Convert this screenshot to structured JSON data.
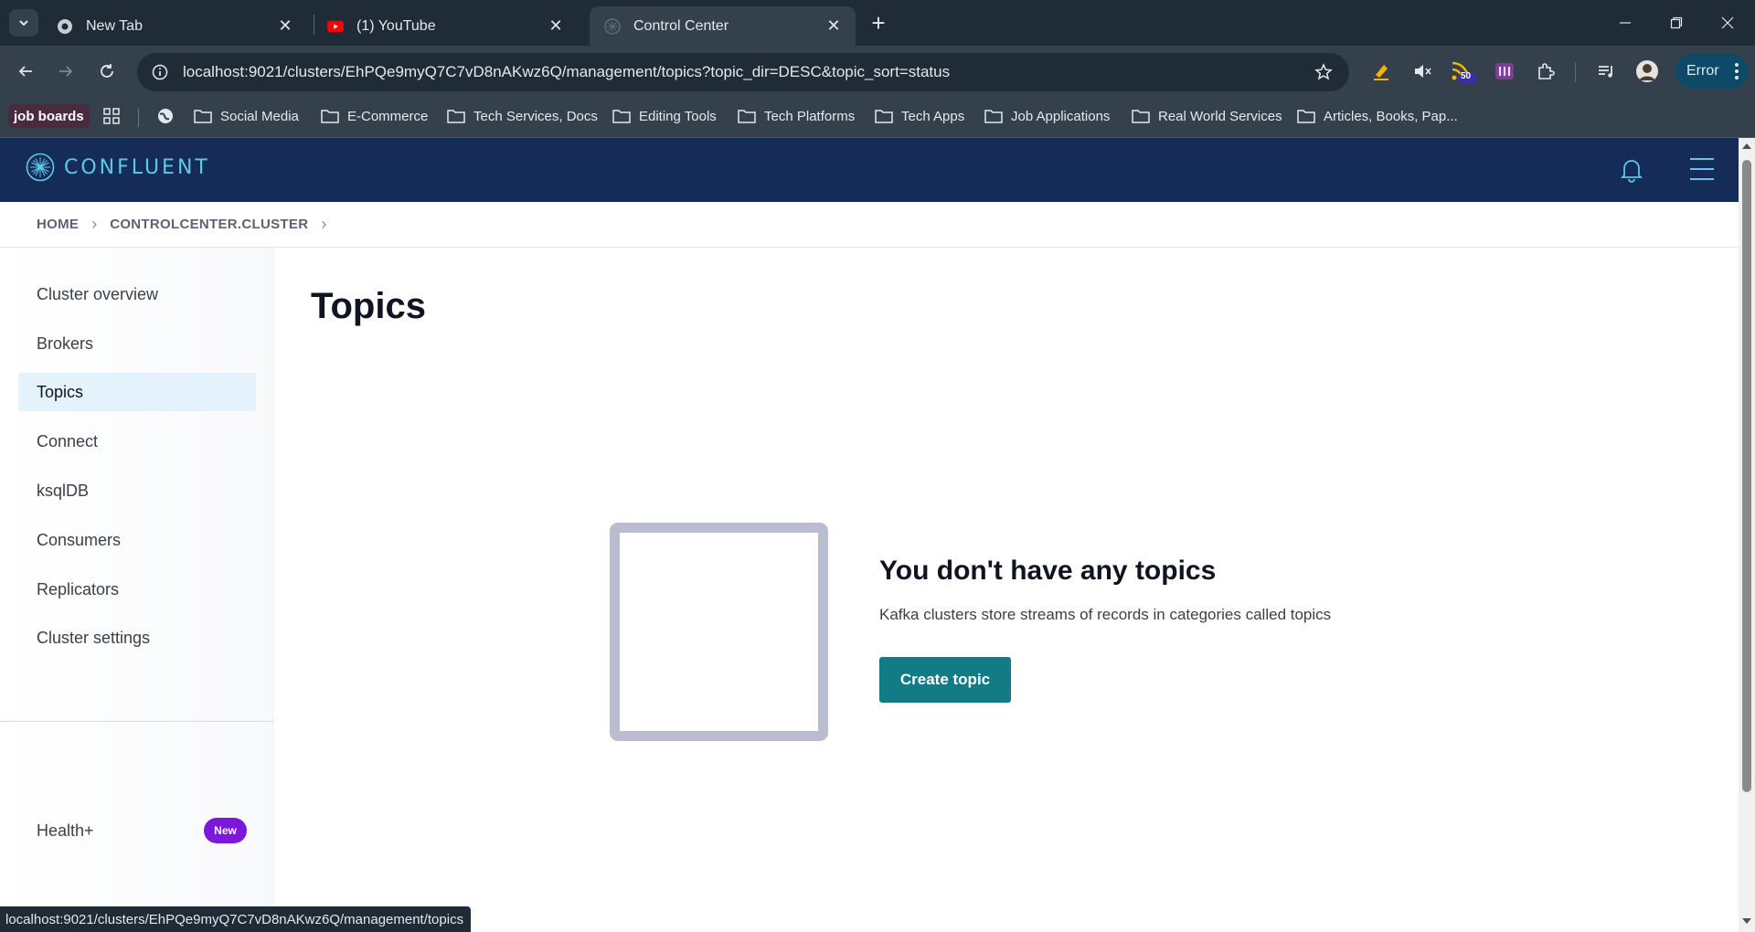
{
  "browser": {
    "tabs": [
      {
        "title": "New Tab",
        "active": false
      },
      {
        "title": "(1) YouTube",
        "active": false
      },
      {
        "title": "Control Center",
        "active": true
      }
    ],
    "url": "localhost:9021/clusters/EhPQe9myQ7C7vD8nAKwz6Q/management/topics?topic_dir=DESC&topic_sort=status",
    "rss_badge_count": "50",
    "profile_status": "Error",
    "bookmarks": {
      "jobs_label": "job boards",
      "folders": [
        "Social Media",
        "E-Commerce",
        "Tech Services, Docs",
        "Editing Tools",
        "Tech Platforms",
        "Tech Apps",
        "Job Applications",
        "Real World Services",
        "Articles, Books, Pap..."
      ]
    },
    "status_url": "localhost:9021/clusters/EhPQe9myQ7C7vD8nAKwz6Q/management/topics"
  },
  "app": {
    "brand": "CONFLUENT",
    "breadcrumb": [
      "HOME",
      "CONTROLCENTER.CLUSTER"
    ],
    "sidebar": {
      "items": [
        {
          "label": "Cluster overview",
          "active": false
        },
        {
          "label": "Brokers",
          "active": false
        },
        {
          "label": "Topics",
          "active": true
        },
        {
          "label": "Connect",
          "active": false
        },
        {
          "label": "ksqlDB",
          "active": false
        },
        {
          "label": "Consumers",
          "active": false
        },
        {
          "label": "Replicators",
          "active": false
        },
        {
          "label": "Cluster settings",
          "active": false
        }
      ],
      "health_label": "Health+",
      "health_badge": "New"
    },
    "page_title": "Topics",
    "empty_state": {
      "title": "You don't have any topics",
      "subtitle": "Kafka clusters store streams of records in categories called topics",
      "button": "Create topic"
    }
  },
  "colors": {
    "appbar": "#142c57",
    "accent_button": "#127b85",
    "badge": "#7b18dc",
    "active_nav": "#e3f2fb"
  }
}
